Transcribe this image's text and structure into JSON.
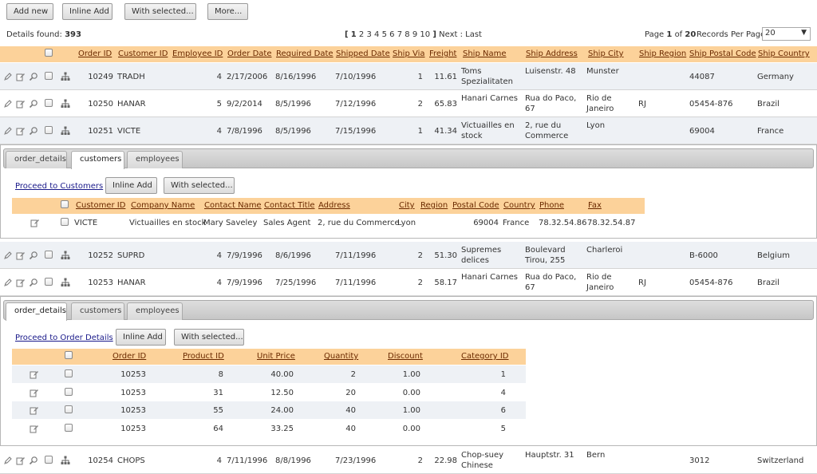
{
  "toolbar": {
    "add_new": "Add new",
    "inline_add": "Inline Add",
    "with_selected": "With selected...",
    "more": "More..."
  },
  "status": {
    "details_label": "Details found:",
    "details_count": "393",
    "pager_open": "[",
    "current_page": "1",
    "pages": [
      "2",
      "3",
      "4",
      "5",
      "6",
      "7",
      "8",
      "9",
      "10"
    ],
    "pager_close": "]",
    "next": "Next",
    "last": "Last",
    "page_word": "Page",
    "of_word": "of",
    "total_pages": "20",
    "records_per_page_label": "Records Per Page:",
    "records_per_page_value": "20"
  },
  "main_table": {
    "columns": [
      "Order ID",
      "Customer ID",
      "Employee ID",
      "Order Date",
      "Required Date",
      "Shipped Date",
      "Ship Via",
      "Freight",
      "Ship Name",
      "Ship Address",
      "Ship City",
      "Ship Region",
      "Ship Postal Code",
      "Ship Country"
    ],
    "rows": [
      [
        "10249",
        "TRADH",
        "4",
        "2/17/2006",
        "8/16/1996",
        "7/10/1996",
        "1",
        "11.61",
        "Toms Spezialitaten",
        "Luisenstr. 48",
        "Munster",
        "",
        "44087",
        "Germany"
      ],
      [
        "10250",
        "HANAR",
        "5",
        "9/2/2014",
        "8/5/1996",
        "7/12/1996",
        "2",
        "65.83",
        "Hanari Carnes",
        "Rua do Paco, 67",
        "Rio de Janeiro",
        "RJ",
        "05454-876",
        "Brazil"
      ],
      [
        "10251",
        "VICTE",
        "4",
        "7/8/1996",
        "8/5/1996",
        "7/15/1996",
        "1",
        "41.34",
        "Victuailles en stock",
        "2, rue du Commerce",
        "Lyon",
        "",
        "69004",
        "France"
      ],
      [
        "10252",
        "SUPRD",
        "4",
        "7/9/1996",
        "8/6/1996",
        "7/11/1996",
        "2",
        "51.30",
        "Supremes delices",
        "Boulevard Tirou, 255",
        "Charleroi",
        "",
        "B-6000",
        "Belgium"
      ],
      [
        "10253",
        "HANAR",
        "4",
        "7/9/1996",
        "7/25/1996",
        "7/11/1996",
        "2",
        "58.17",
        "Hanari Carnes",
        "Rua do Paco, 67",
        "Rio de Janeiro",
        "RJ",
        "05454-876",
        "Brazil"
      ],
      [
        "10254",
        "CHOPS",
        "4",
        "7/11/1996",
        "8/8/1996",
        "7/23/1996",
        "2",
        "22.98",
        "Chop-suey Chinese",
        "Hauptstr. 31",
        "Bern",
        "",
        "3012",
        "Switzerland"
      ]
    ]
  },
  "details1": {
    "tabs": [
      "order_details",
      "customers",
      "employees"
    ],
    "active_tab": "customers",
    "proceed_link": "Proceed to Customers",
    "inline_add": "Inline Add",
    "with_selected": "With selected...",
    "columns": [
      "Customer ID",
      "Company Name",
      "Contact Name",
      "Contact Title",
      "Address",
      "City",
      "Region",
      "Postal Code",
      "Country",
      "Phone",
      "Fax"
    ],
    "row": [
      "VICTE",
      "Victuailles en stock",
      "Mary Saveley",
      "Sales Agent",
      "2, rue du Commerce",
      "Lyon",
      "",
      "69004",
      "France",
      "78.32.54.86",
      "78.32.54.87"
    ]
  },
  "details2": {
    "tabs": [
      "order_details",
      "customers",
      "employees"
    ],
    "active_tab": "order_details",
    "proceed_link": "Proceed to Order Details",
    "inline_add": "Inline Add",
    "with_selected": "With selected...",
    "columns": [
      "Order ID",
      "Product ID",
      "Unit Price",
      "Quantity",
      "Discount",
      "Category ID"
    ],
    "rows": [
      [
        "10253",
        "8",
        "40.00",
        "2",
        "1.00",
        "1"
      ],
      [
        "10253",
        "31",
        "12.50",
        "20",
        "0.00",
        "4"
      ],
      [
        "10253",
        "55",
        "24.00",
        "40",
        "1.00",
        "6"
      ],
      [
        "10253",
        "64",
        "33.25",
        "40",
        "0.00",
        "5"
      ]
    ]
  },
  "icons": {
    "row_actions": [
      "edit-icon",
      "inline-edit-icon",
      "view-icon",
      "hierarchy-icon"
    ],
    "sub_action": "inline-edit-icon",
    "dropdown": "chevron-down-icon"
  },
  "colors": {
    "header_band": "#fcd29a",
    "header_text": "#6b2a00",
    "row_odd": "#eef1f5",
    "row_even": "#ffffff",
    "link": "#1a1a8a"
  }
}
